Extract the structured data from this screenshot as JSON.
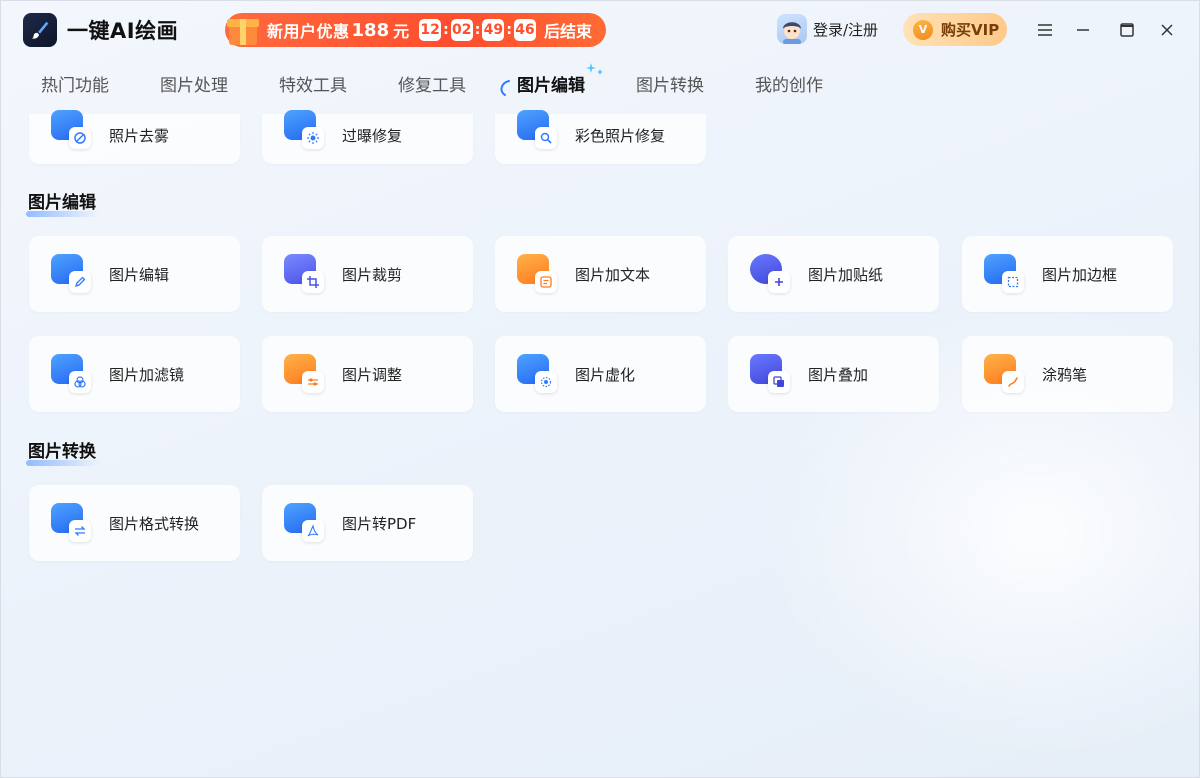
{
  "app": {
    "title": "一键AI绘画"
  },
  "promo": {
    "text": "新用户优惠",
    "amount": "188",
    "unit": "元",
    "timer": [
      "12",
      "02",
      "49",
      "46"
    ],
    "end": "后结束"
  },
  "user": {
    "login": "登录/注册"
  },
  "vip": {
    "badge": "V",
    "label": "购买VIP"
  },
  "tabs": [
    {
      "label": "热门功能"
    },
    {
      "label": "图片处理"
    },
    {
      "label": "特效工具"
    },
    {
      "label": "修复工具"
    },
    {
      "label": "图片编辑",
      "active": true
    },
    {
      "label": "图片转换"
    },
    {
      "label": "我的创作"
    }
  ],
  "top_row": [
    {
      "label": "照片去雾"
    },
    {
      "label": "过曝修复"
    },
    {
      "label": "彩色照片修复"
    }
  ],
  "sections": [
    {
      "title": "图片编辑",
      "items": [
        {
          "label": "图片编辑"
        },
        {
          "label": "图片裁剪"
        },
        {
          "label": "图片加文本"
        },
        {
          "label": "图片加贴纸"
        },
        {
          "label": "图片加边框"
        },
        {
          "label": "图片加滤镜"
        },
        {
          "label": "图片调整"
        },
        {
          "label": "图片虚化"
        },
        {
          "label": "图片叠加"
        },
        {
          "label": "涂鸦笔"
        }
      ]
    },
    {
      "title": "图片转换",
      "items": [
        {
          "label": "图片格式转换"
        },
        {
          "label": "图片转PDF"
        }
      ]
    }
  ],
  "colors": {
    "brand_blue": "#2f7bff",
    "promo_orange": "#ff4d2e",
    "vip_gold": "#ffc98a"
  }
}
